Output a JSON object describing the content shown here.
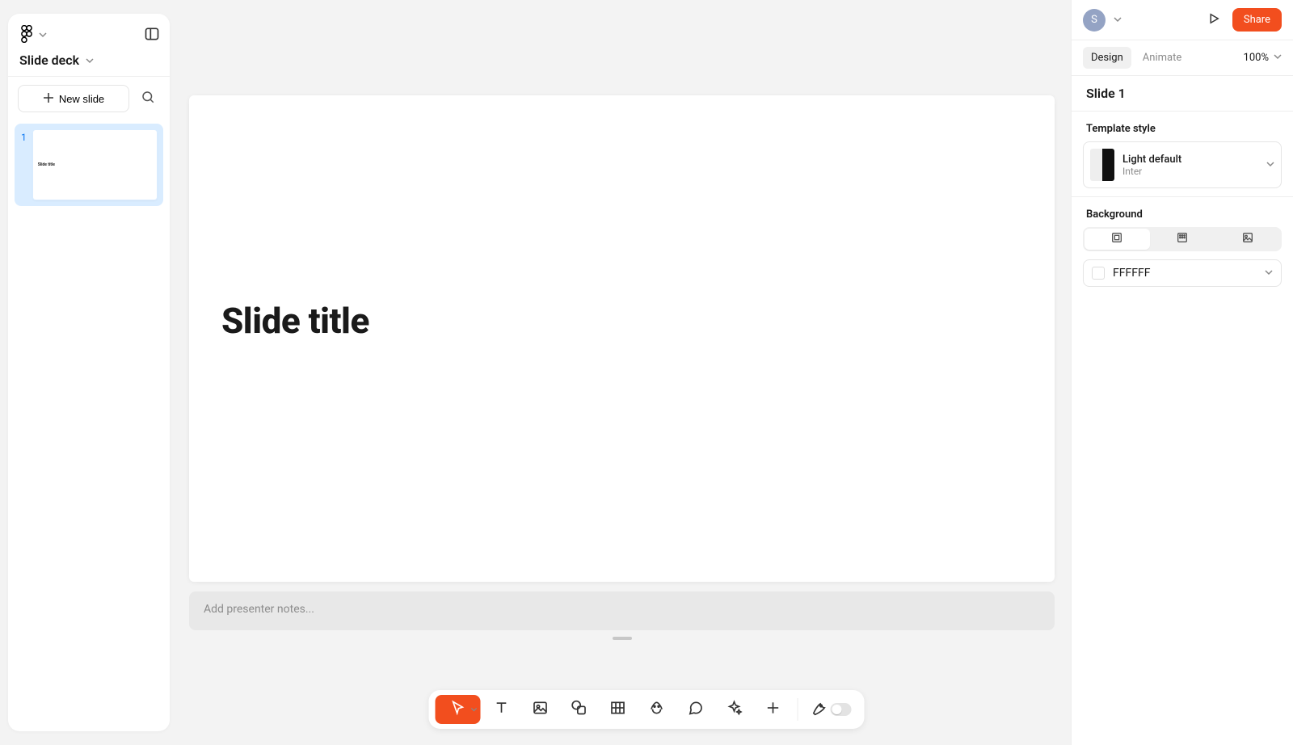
{
  "file": {
    "name": "Slide deck"
  },
  "left": {
    "new_slide_label": "New slide"
  },
  "thumbs": [
    {
      "number": "1",
      "label": "Slide title"
    }
  ],
  "canvas": {
    "slide_title": "Slide title",
    "notes_placeholder": "Add presenter notes..."
  },
  "right": {
    "avatar_initial": "S",
    "share_label": "Share",
    "tabs": {
      "design": "Design",
      "animate": "Animate"
    },
    "zoom_label": "100%",
    "slide_header": "Slide 1",
    "template_section_label": "Template style",
    "template": {
      "name": "Light default",
      "font": "Inter"
    },
    "background_section_label": "Background",
    "bg_color": "FFFFFF"
  }
}
